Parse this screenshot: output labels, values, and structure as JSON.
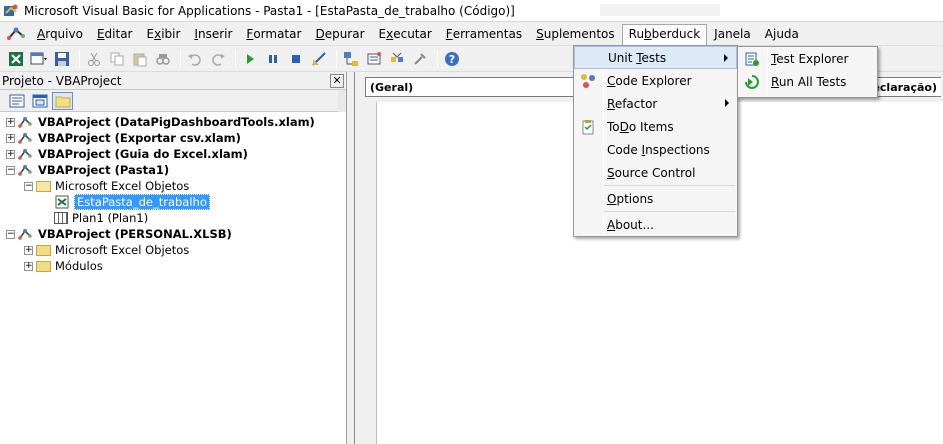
{
  "window": {
    "title": "Microsoft Visual Basic for Applications - Pasta1 - [EstaPasta_de_trabalho (Código)]"
  },
  "menubar": {
    "items": [
      {
        "label": "Arquivo"
      },
      {
        "label": "Editar"
      },
      {
        "label": "Exibir"
      },
      {
        "label": "Inserir"
      },
      {
        "label": "Formatar"
      },
      {
        "label": "Depurar"
      },
      {
        "label": "Executar"
      },
      {
        "label": "Ferramentas"
      },
      {
        "label": "Suplementos"
      },
      {
        "label": "Rubberduck"
      },
      {
        "label": "Janela"
      },
      {
        "label": "Ajuda"
      }
    ],
    "active_index": 9
  },
  "project_pane": {
    "title": "Projeto - VBAProject",
    "close_label": "✕",
    "tree": [
      {
        "label": "VBAProject (DataPigDashboardTools.xlam)",
        "level": 0,
        "expander": "+",
        "bold": true,
        "type": "project"
      },
      {
        "label": "VBAProject (Exportar csv.xlam)",
        "level": 0,
        "expander": "+",
        "bold": true,
        "type": "project"
      },
      {
        "label": "VBAProject (Guia do Excel.xlam)",
        "level": 0,
        "expander": "+",
        "bold": true,
        "type": "project"
      },
      {
        "label": "VBAProject (Pasta1)",
        "level": 0,
        "expander": "−",
        "bold": true,
        "type": "project"
      },
      {
        "label": "Microsoft Excel Objetos",
        "level": 1,
        "expander": "−",
        "bold": false,
        "type": "folder-open"
      },
      {
        "label": "EstaPasta_de_trabalho",
        "level": 2,
        "expander": "",
        "bold": false,
        "type": "workbook",
        "selected": true
      },
      {
        "label": "Plan1 (Plan1)",
        "level": 2,
        "expander": "",
        "bold": false,
        "type": "sheet"
      },
      {
        "label": "VBAProject (PERSONAL.XLSB)",
        "level": 0,
        "expander": "−",
        "bold": true,
        "type": "project"
      },
      {
        "label": "Microsoft Excel Objetos",
        "level": 1,
        "expander": "+",
        "bold": false,
        "type": "folder"
      },
      {
        "label": "Módulos",
        "level": 1,
        "expander": "+",
        "bold": false,
        "type": "folder"
      }
    ]
  },
  "code_pane": {
    "object_combo": "(Geral)",
    "procedure_combo": "(Declaração)"
  },
  "rubberduck_menu": {
    "items": [
      {
        "label": "Unit Tests",
        "ul": "T",
        "submenu": true,
        "highlight": true,
        "icon": "none"
      },
      {
        "label": "Code Explorer",
        "ul": "C",
        "submenu": false,
        "icon": "code-explorer-icon"
      },
      {
        "label": "Refactor",
        "ul": "R",
        "submenu": true,
        "icon": "none"
      },
      {
        "label": "ToDo Items",
        "ul": "D",
        "submenu": false,
        "icon": "todo-icon"
      },
      {
        "label": "Code Inspections",
        "ul": "I",
        "submenu": false,
        "icon": "none"
      },
      {
        "label": "Source Control",
        "ul": "S",
        "submenu": false,
        "icon": "none"
      },
      {
        "label": "Options",
        "ul": "O",
        "submenu": false,
        "icon": "none",
        "sep_before": true
      },
      {
        "label": "About...",
        "ul": "A",
        "submenu": false,
        "icon": "none",
        "sep_before": true
      }
    ]
  },
  "unit_tests_submenu": {
    "items": [
      {
        "label": "Test Explorer",
        "ul": "T",
        "icon": "test-explorer-icon"
      },
      {
        "label": "Run All Tests",
        "ul": "R",
        "icon": "run-all-tests-icon"
      }
    ]
  },
  "colors": {
    "selection": "#3399ff",
    "menu_highlight": "#dde9f7",
    "folder": "#f3dc82"
  }
}
